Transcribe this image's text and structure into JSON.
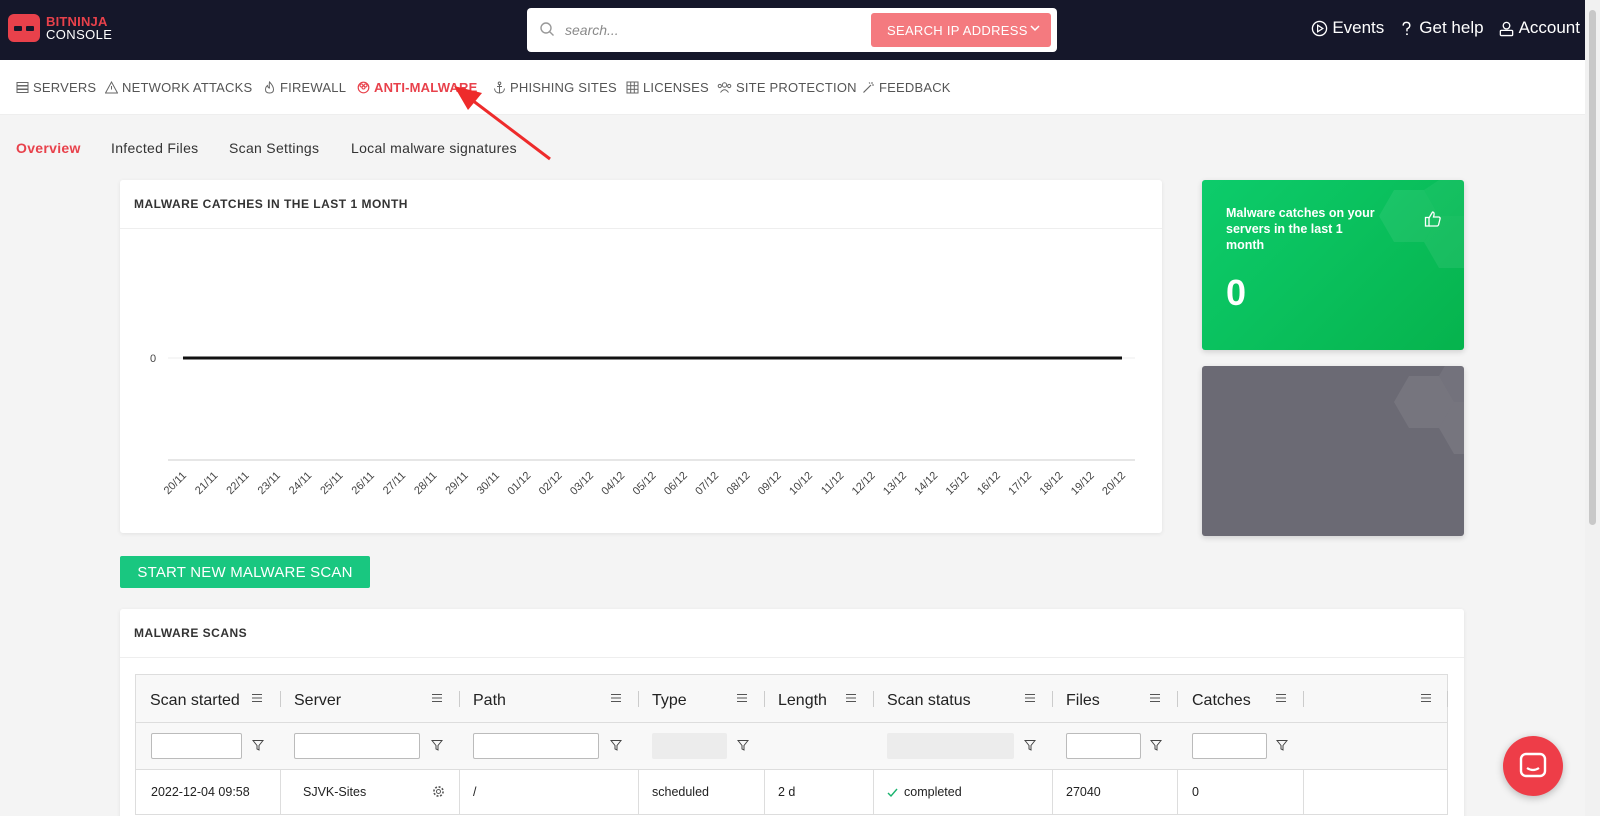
{
  "brand": {
    "line1": "BITNINJA",
    "line2": "CONSOLE"
  },
  "search": {
    "placeholder": "search...",
    "button_label": "SEARCH IP ADDRESS"
  },
  "top_links": [
    {
      "label": "Events",
      "icon": "play-circle-icon"
    },
    {
      "label": "Get help",
      "icon": "question-icon"
    },
    {
      "label": "Account",
      "icon": "account-icon"
    }
  ],
  "nav": {
    "items": [
      {
        "label": "SERVERS",
        "icon": "server-icon"
      },
      {
        "label": "NETWORK ATTACKS",
        "icon": "warning-icon"
      },
      {
        "label": "FIREWALL",
        "icon": "flame-icon"
      },
      {
        "label": "ANTI-MALWARE",
        "icon": "biohazard-icon",
        "active": true
      },
      {
        "label": "PHISHING SITES",
        "icon": "anchor-icon"
      },
      {
        "label": "LICENSES",
        "icon": "grid-icon"
      },
      {
        "label": "SITE PROTECTION",
        "icon": "users-icon"
      },
      {
        "label": "FEEDBACK",
        "icon": "wand-icon"
      }
    ]
  },
  "subtabs": [
    {
      "label": "Overview",
      "active": true
    },
    {
      "label": "Infected Files"
    },
    {
      "label": "Scan Settings"
    },
    {
      "label": "Local malware signatures"
    }
  ],
  "chart_card": {
    "title": "MALWARE CATCHES IN THE LAST 1 MONTH"
  },
  "chart_data": {
    "type": "line",
    "title": "MALWARE CATCHES IN THE LAST 1 MONTH",
    "x": [
      "20/11",
      "21/11",
      "22/11",
      "23/11",
      "24/11",
      "25/11",
      "26/11",
      "27/11",
      "28/11",
      "29/11",
      "30/11",
      "01/12",
      "02/12",
      "03/12",
      "04/12",
      "05/12",
      "06/12",
      "07/12",
      "08/12",
      "09/12",
      "10/12",
      "11/12",
      "12/12",
      "13/12",
      "14/12",
      "15/12",
      "16/12",
      "17/12",
      "18/12",
      "19/12",
      "20/12"
    ],
    "series": [
      {
        "values": [
          0,
          0,
          0,
          0,
          0,
          0,
          0,
          0,
          0,
          0,
          0,
          0,
          0,
          0,
          0,
          0,
          0,
          0,
          0,
          0,
          0,
          0,
          0,
          0,
          0,
          0,
          0,
          0,
          0,
          0,
          0
        ]
      }
    ],
    "yticks": [
      "0"
    ],
    "line_color": "#111111",
    "grid": true
  },
  "green_card": {
    "title": "Malware catches on your servers in the last 1 month",
    "value": "0",
    "color": "#0cc464"
  },
  "gray_card": {
    "color": "#6b6a74"
  },
  "start_button": {
    "label": "START NEW MALWARE SCAN",
    "color": "#19c780"
  },
  "scans_card": {
    "title": "MALWARE SCANS"
  },
  "table": {
    "columns": [
      "Scan started",
      "Server",
      "Path",
      "Type",
      "Length",
      "Scan status",
      "Files",
      "Catches",
      ""
    ],
    "rows": [
      {
        "scan_started": "2022-12-04 09:58",
        "server": "SJVK-Sites",
        "path": "/",
        "type": "scheduled",
        "length": "2 d",
        "status": "completed",
        "files": "27040",
        "catches": "0"
      }
    ]
  },
  "colors": {
    "accent": "#e8414b",
    "topbar": "#15172a"
  }
}
